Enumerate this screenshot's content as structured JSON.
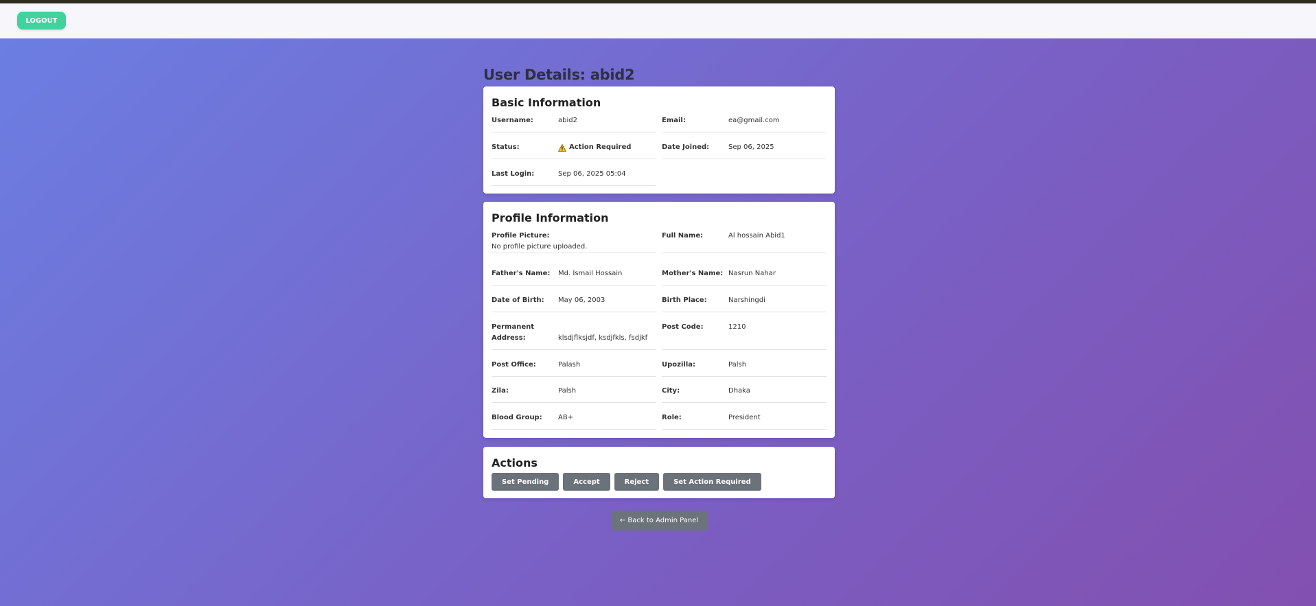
{
  "header": {
    "logout_label": "LOGOUT"
  },
  "page": {
    "title": "User Details: abid2"
  },
  "basic": {
    "title": "Basic Information",
    "username_label": "Username:",
    "username": "abid2",
    "email_label": "Email:",
    "email": "ea@gmail.com",
    "status_label": "Status:",
    "status": "Action Required",
    "status_icon": "warning-icon",
    "date_joined_label": "Date Joined:",
    "date_joined": "Sep 06, 2025",
    "last_login_label": "Last Login:",
    "last_login": "Sep 06, 2025 05:04"
  },
  "profile": {
    "title": "Profile Information",
    "picture_label": "Profile Picture:",
    "picture": "No profile picture uploaded.",
    "full_name_label": "Full Name:",
    "full_name": "Al hossain Abid1",
    "father_label": "Father's Name:",
    "father": "Md. Ismail Hossain",
    "mother_label": "Mother's Name:",
    "mother": "Nasrun Nahar",
    "dob_label": "Date of Birth:",
    "dob": "May 06, 2003",
    "birth_place_label": "Birth Place:",
    "birth_place": "Narshingdi",
    "perm_address_label": "Permanent Address:",
    "perm_address": "klsdjflksjdf, ksdjfkls, fsdjkf",
    "post_code_label": "Post Code:",
    "post_code": "1210",
    "post_office_label": "Post Office:",
    "post_office": "Palash",
    "upozilla_label": "Upozilla:",
    "upozilla": "Palsh",
    "zila_label": "Zila:",
    "zila": "Palsh",
    "city_label": "City:",
    "city": "Dhaka",
    "blood_label": "Blood Group:",
    "blood": "AB+",
    "role_label": "Role:",
    "role": "President"
  },
  "actions": {
    "title": "Actions",
    "set_pending": "Set Pending",
    "accept": "Accept",
    "reject": "Reject",
    "set_action_required": "Set Action Required"
  },
  "back_label": "← Back to Admin Panel",
  "colors": {
    "accent": "#3fd39e",
    "button_gray": "#6b7279"
  }
}
